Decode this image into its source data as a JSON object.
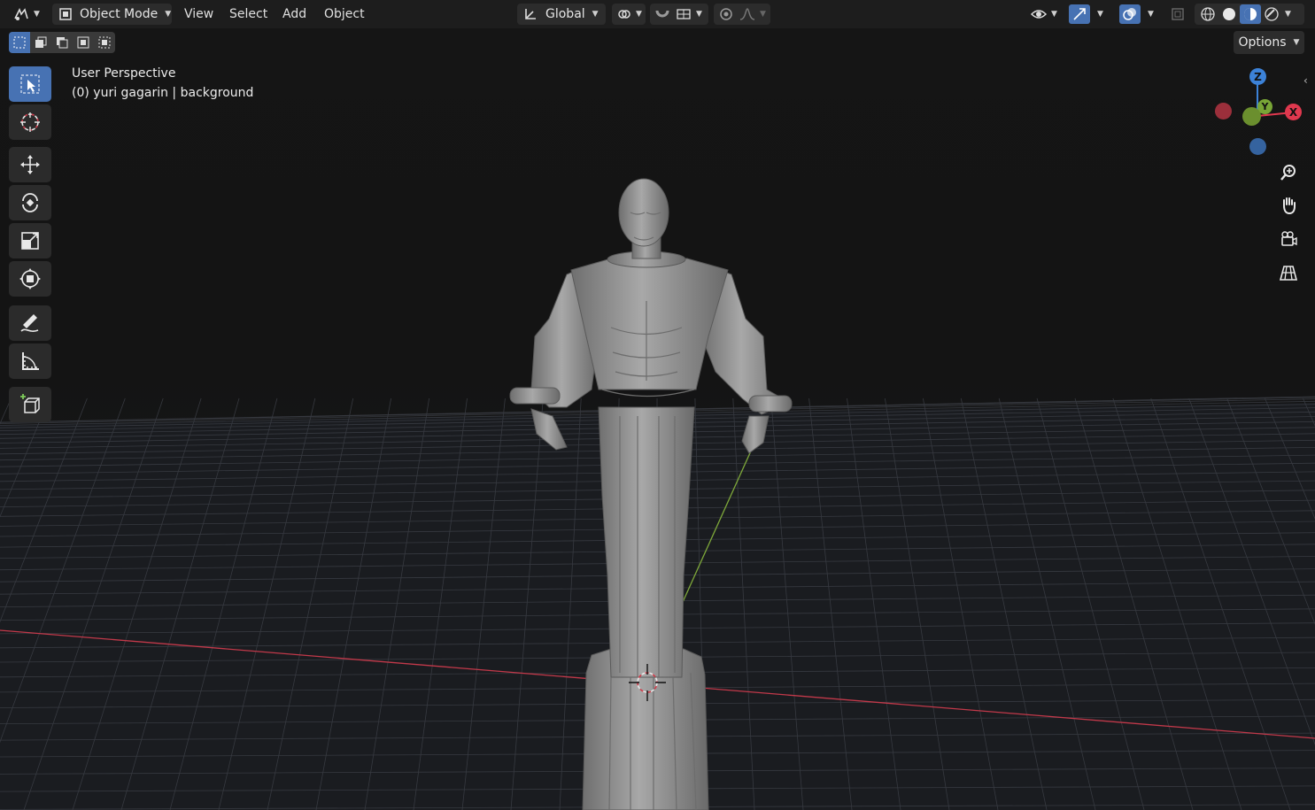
{
  "header": {
    "mode_label": "Object Mode",
    "menus": [
      "View",
      "Select",
      "Add",
      "Object"
    ],
    "orientation_label": "Global",
    "options_label": "Options"
  },
  "viewport": {
    "view_name": "User Perspective",
    "object_info": "(0) yuri gagarin | background"
  },
  "gizmo": {
    "x_label": "X",
    "y_label": "Y",
    "z_label": "Z",
    "colors": {
      "x": "#e0384e",
      "y": "#78a536",
      "z": "#3c82d8",
      "x_neg": "#9b2f3b",
      "z_neg": "#35639f"
    }
  },
  "toolbar": {
    "tools": [
      "select-box-tool",
      "cursor-tool",
      "move-tool",
      "rotate-tool",
      "scale-tool",
      "transform-tool",
      "annotate-tool",
      "measure-tool",
      "add-cube-tool"
    ],
    "active": "select-box-tool"
  },
  "nav_buttons": [
    "zoom-icon",
    "hand-icon",
    "camera-icon",
    "grid-perspective-icon"
  ],
  "theme": {
    "accent": "#4772b3",
    "x_axis_line": "#c2394a",
    "y_axis_line": "#7ea83a"
  }
}
